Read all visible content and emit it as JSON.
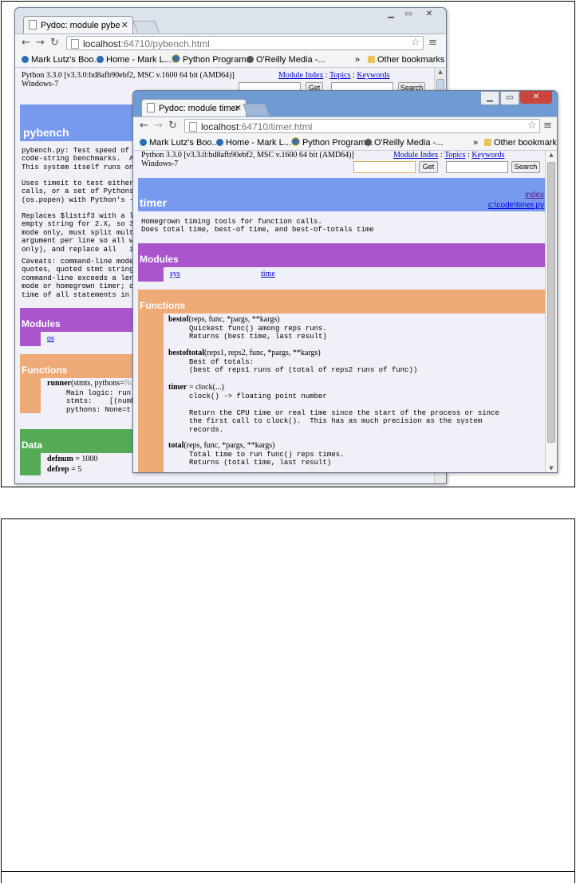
{
  "back_window": {
    "tab_title": "Pydoc: module pybe",
    "url_host": "localhost",
    "url_path": ":64710/pybench.html",
    "bookmarks": [
      "Mark Lutz's Boo...",
      "Home - Mark L...",
      "Python Program...",
      "O'Reilly Media -...",
      "Other bookmarks"
    ],
    "header_line1": "Python 3.3.0 [v3.3.0:bd8afb90ebf2, MSC v.1600 64 bit (AMD64)]",
    "header_line2": "Windows-7",
    "links": {
      "module_index": "Module Index",
      "topics": "Topics",
      "keywords": "Keywords",
      "sep": ":"
    },
    "get_label": "Get",
    "search_label": "Search",
    "module_title": "pybench",
    "doc_paragraphs": [
      "pybench.py: Test speed of on\ncode-string benchmarks.  A f\nThis system itself runs on b",
      "Uses timeit to test either t\ncalls, or a set of Pythons b\n(os.popen) with Python's -m",
      "Replaces $listif3 with a lis\nempty string for 2.X, so 3.X\nmode only, must split multil\nargument per line so all wil\nonly), and replace all   in",
      "Caveats: command-line mode (\nquotes, quoted stmt string i\ncommand-line exceeds a lengt\nmode or homegrown timer; doe\ntime of all statements in th"
    ],
    "modules_heading": "Modules",
    "modules": [
      "os"
    ],
    "functions_heading": "Functions",
    "runner_name": "runner",
    "runner_sig": "(stmts, pythons=",
    "runner_default": "No",
    "runner_doc": "Main logic: run\nstmts:    [(numb\npythons: None=t",
    "data_heading": "Data",
    "data_items": [
      {
        "name": "defnum",
        "value": " = 1000"
      },
      {
        "name": "defrep",
        "value": " = 5"
      }
    ]
  },
  "front_window": {
    "tab_title": "Pydoc: module timer",
    "url_host": "localhost",
    "url_path": ":64710/timer.html",
    "bookmarks": [
      "Mark Lutz's Boo...",
      "Home - Mark L...",
      "Python Program...",
      "O'Reilly Media -...",
      "Other bookmarks"
    ],
    "header_line1": "Python 3.3.0 [v3.3.0:bd8afb90ebf2, MSC v.1600 64 bit (AMD64)]",
    "header_line2": "Windows-7",
    "links": {
      "module_index": "Module Index",
      "topics": "Topics",
      "keywords": "Keywords",
      "sep": ":"
    },
    "get_label": "Get",
    "search_label": "Search",
    "module_title": "timer",
    "index_link": "index",
    "file_link": "c:\\code\\timer.py",
    "doc": "Homegrown timing tools for function calls.\nDoes total time, best-of time, and best-of-totals time",
    "modules_heading": "Modules",
    "modules": [
      "sys",
      "time"
    ],
    "functions_heading": "Functions",
    "functions": [
      {
        "name": "bestof",
        "sig": "(reps, func, *pargs, **kargs)",
        "doc": "Quickest func() among reps runs.\nReturns (best time, last result)"
      },
      {
        "name": "bestoftotal",
        "sig": "(reps1, reps2, func, *pargs, **kargs)",
        "doc": "Best of totals:\n(best of reps1 runs of (total of reps2 runs of func))"
      },
      {
        "name": "timer",
        "sig": " = clock(...)",
        "doc": "clock() -> floating point number\n\nReturn the CPU time or real time since the start of the process or since\nthe first call to clock().  This has as much precision as the system\nrecords."
      },
      {
        "name": "total",
        "sig": "(reps, func, *pargs, **kargs)",
        "doc": "Total time to run func() reps times.\nReturns (total time, last result)"
      }
    ]
  },
  "colors": {
    "module_band": "#7799ee",
    "modules_band": "#aa55cc",
    "functions_band": "#eeaa77",
    "data_band": "#55aa55",
    "page_bg": "#f0f0f8"
  }
}
